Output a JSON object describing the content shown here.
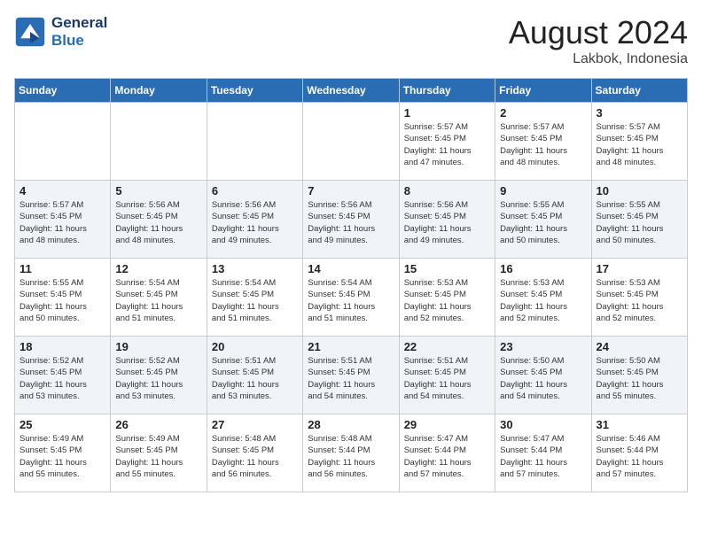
{
  "header": {
    "logo_line1": "General",
    "logo_line2": "Blue",
    "month_year": "August 2024",
    "location": "Lakbok, Indonesia"
  },
  "days_of_week": [
    "Sunday",
    "Monday",
    "Tuesday",
    "Wednesday",
    "Thursday",
    "Friday",
    "Saturday"
  ],
  "weeks": [
    [
      {
        "day": "",
        "info": ""
      },
      {
        "day": "",
        "info": ""
      },
      {
        "day": "",
        "info": ""
      },
      {
        "day": "",
        "info": ""
      },
      {
        "day": "1",
        "info": "Sunrise: 5:57 AM\nSunset: 5:45 PM\nDaylight: 11 hours\nand 47 minutes."
      },
      {
        "day": "2",
        "info": "Sunrise: 5:57 AM\nSunset: 5:45 PM\nDaylight: 11 hours\nand 48 minutes."
      },
      {
        "day": "3",
        "info": "Sunrise: 5:57 AM\nSunset: 5:45 PM\nDaylight: 11 hours\nand 48 minutes."
      }
    ],
    [
      {
        "day": "4",
        "info": "Sunrise: 5:57 AM\nSunset: 5:45 PM\nDaylight: 11 hours\nand 48 minutes."
      },
      {
        "day": "5",
        "info": "Sunrise: 5:56 AM\nSunset: 5:45 PM\nDaylight: 11 hours\nand 48 minutes."
      },
      {
        "day": "6",
        "info": "Sunrise: 5:56 AM\nSunset: 5:45 PM\nDaylight: 11 hours\nand 49 minutes."
      },
      {
        "day": "7",
        "info": "Sunrise: 5:56 AM\nSunset: 5:45 PM\nDaylight: 11 hours\nand 49 minutes."
      },
      {
        "day": "8",
        "info": "Sunrise: 5:56 AM\nSunset: 5:45 PM\nDaylight: 11 hours\nand 49 minutes."
      },
      {
        "day": "9",
        "info": "Sunrise: 5:55 AM\nSunset: 5:45 PM\nDaylight: 11 hours\nand 50 minutes."
      },
      {
        "day": "10",
        "info": "Sunrise: 5:55 AM\nSunset: 5:45 PM\nDaylight: 11 hours\nand 50 minutes."
      }
    ],
    [
      {
        "day": "11",
        "info": "Sunrise: 5:55 AM\nSunset: 5:45 PM\nDaylight: 11 hours\nand 50 minutes."
      },
      {
        "day": "12",
        "info": "Sunrise: 5:54 AM\nSunset: 5:45 PM\nDaylight: 11 hours\nand 51 minutes."
      },
      {
        "day": "13",
        "info": "Sunrise: 5:54 AM\nSunset: 5:45 PM\nDaylight: 11 hours\nand 51 minutes."
      },
      {
        "day": "14",
        "info": "Sunrise: 5:54 AM\nSunset: 5:45 PM\nDaylight: 11 hours\nand 51 minutes."
      },
      {
        "day": "15",
        "info": "Sunrise: 5:53 AM\nSunset: 5:45 PM\nDaylight: 11 hours\nand 52 minutes."
      },
      {
        "day": "16",
        "info": "Sunrise: 5:53 AM\nSunset: 5:45 PM\nDaylight: 11 hours\nand 52 minutes."
      },
      {
        "day": "17",
        "info": "Sunrise: 5:53 AM\nSunset: 5:45 PM\nDaylight: 11 hours\nand 52 minutes."
      }
    ],
    [
      {
        "day": "18",
        "info": "Sunrise: 5:52 AM\nSunset: 5:45 PM\nDaylight: 11 hours\nand 53 minutes."
      },
      {
        "day": "19",
        "info": "Sunrise: 5:52 AM\nSunset: 5:45 PM\nDaylight: 11 hours\nand 53 minutes."
      },
      {
        "day": "20",
        "info": "Sunrise: 5:51 AM\nSunset: 5:45 PM\nDaylight: 11 hours\nand 53 minutes."
      },
      {
        "day": "21",
        "info": "Sunrise: 5:51 AM\nSunset: 5:45 PM\nDaylight: 11 hours\nand 54 minutes."
      },
      {
        "day": "22",
        "info": "Sunrise: 5:51 AM\nSunset: 5:45 PM\nDaylight: 11 hours\nand 54 minutes."
      },
      {
        "day": "23",
        "info": "Sunrise: 5:50 AM\nSunset: 5:45 PM\nDaylight: 11 hours\nand 54 minutes."
      },
      {
        "day": "24",
        "info": "Sunrise: 5:50 AM\nSunset: 5:45 PM\nDaylight: 11 hours\nand 55 minutes."
      }
    ],
    [
      {
        "day": "25",
        "info": "Sunrise: 5:49 AM\nSunset: 5:45 PM\nDaylight: 11 hours\nand 55 minutes."
      },
      {
        "day": "26",
        "info": "Sunrise: 5:49 AM\nSunset: 5:45 PM\nDaylight: 11 hours\nand 55 minutes."
      },
      {
        "day": "27",
        "info": "Sunrise: 5:48 AM\nSunset: 5:45 PM\nDaylight: 11 hours\nand 56 minutes."
      },
      {
        "day": "28",
        "info": "Sunrise: 5:48 AM\nSunset: 5:44 PM\nDaylight: 11 hours\nand 56 minutes."
      },
      {
        "day": "29",
        "info": "Sunrise: 5:47 AM\nSunset: 5:44 PM\nDaylight: 11 hours\nand 57 minutes."
      },
      {
        "day": "30",
        "info": "Sunrise: 5:47 AM\nSunset: 5:44 PM\nDaylight: 11 hours\nand 57 minutes."
      },
      {
        "day": "31",
        "info": "Sunrise: 5:46 AM\nSunset: 5:44 PM\nDaylight: 11 hours\nand 57 minutes."
      }
    ]
  ]
}
